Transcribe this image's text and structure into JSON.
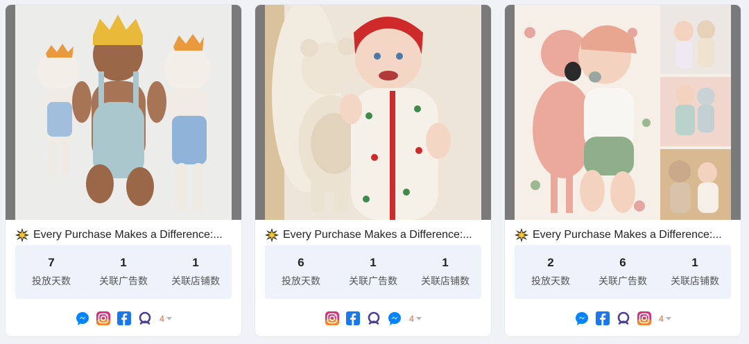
{
  "cards": [
    {
      "title": "Every Purchase Makes a Difference:...",
      "stats": [
        {
          "value": "7",
          "label": "投放天数"
        },
        {
          "value": "1",
          "label": "关联广告数"
        },
        {
          "value": "1",
          "label": "关联店铺数"
        }
      ],
      "platforms": [
        "messenger-icon",
        "instagram-icon",
        "facebook-icon",
        "audience-network-icon"
      ],
      "more_count": "4"
    },
    {
      "title": "Every Purchase Makes a Difference:...",
      "stats": [
        {
          "value": "6",
          "label": "投放天数"
        },
        {
          "value": "1",
          "label": "关联广告数"
        },
        {
          "value": "1",
          "label": "关联店铺数"
        }
      ],
      "platforms": [
        "instagram-icon",
        "facebook-icon",
        "audience-network-icon",
        "messenger-icon"
      ],
      "more_count": "4"
    },
    {
      "title": "Every Purchase Makes a Difference:...",
      "stats": [
        {
          "value": "2",
          "label": "投放天数"
        },
        {
          "value": "6",
          "label": "关联广告数"
        },
        {
          "value": "1",
          "label": "关联店铺数"
        }
      ],
      "platforms": [
        "messenger-icon",
        "facebook-icon",
        "audience-network-icon",
        "instagram-icon"
      ],
      "more_count": "4"
    }
  ],
  "colors": {
    "card_background": "#ffffff",
    "stats_background": "#eef3fb",
    "more_count": "#e8703a",
    "facebook": "#1877f2",
    "messenger": "#0084ff",
    "audience_network": "#4b3f9e"
  }
}
